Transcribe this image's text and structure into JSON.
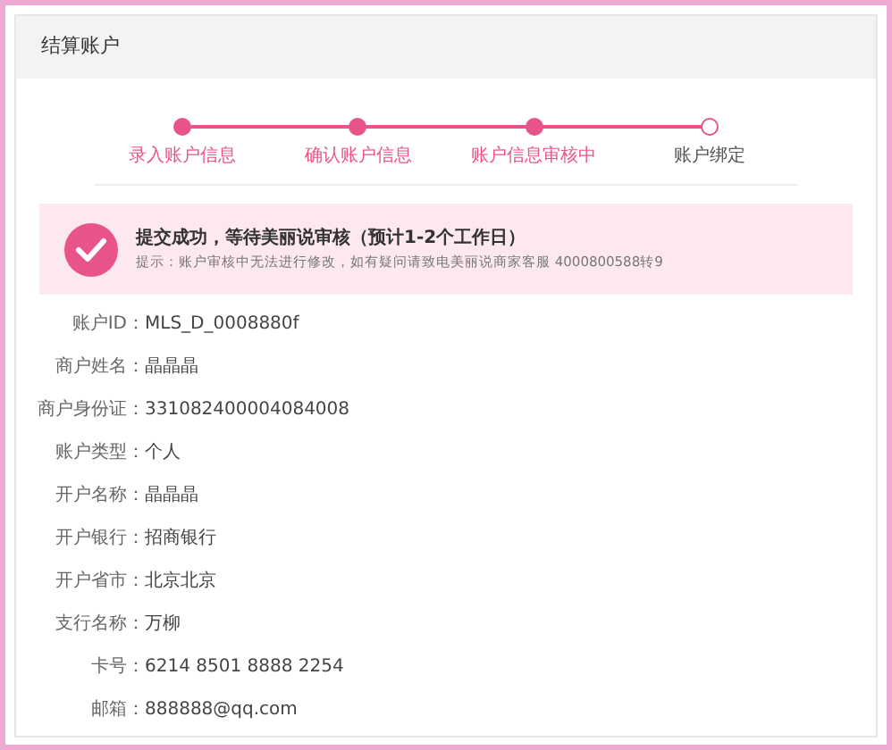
{
  "card": {
    "title": "结算账户"
  },
  "steps": [
    {
      "label": "录入账户信息",
      "done": true
    },
    {
      "label": "确认账户信息",
      "done": true
    },
    {
      "label": "账户信息审核中",
      "done": true
    },
    {
      "label": "账户绑定",
      "done": false
    }
  ],
  "alert": {
    "title": "提交成功，等待美丽说审核（预计1-2个工作日）",
    "message": "提示：账户审核中无法进行修改，如有疑问请致电美丽说商家客服 4000800588转9"
  },
  "fields": [
    {
      "label": "账户ID：",
      "value": "MLS_D_0008880f"
    },
    {
      "label": "商户姓名：",
      "value": "晶晶晶"
    },
    {
      "label": "商户身份证：",
      "value": "331082400004084008"
    },
    {
      "label": "账户类型：",
      "value": "个人"
    },
    {
      "label": "开户名称：",
      "value": "晶晶晶"
    },
    {
      "label": "开户银行：",
      "value": "招商银行"
    },
    {
      "label": "开户省市：",
      "value": "北京北京"
    },
    {
      "label": "支行名称：",
      "value": "万柳"
    },
    {
      "label": "卡号：",
      "value": "6214 8501 8888 2254"
    },
    {
      "label": "邮箱：",
      "value": "888888@qq.com"
    }
  ]
}
